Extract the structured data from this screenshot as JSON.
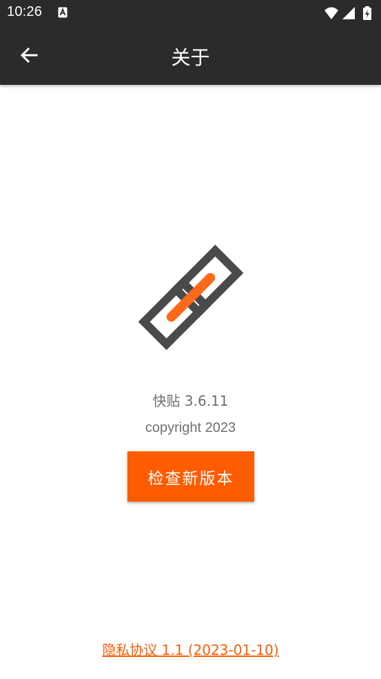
{
  "status_bar": {
    "time": "10:26",
    "icons": [
      "a-notification-icon",
      "wifi-icon",
      "cellular-signal-icon",
      "battery-charging-icon"
    ]
  },
  "app_bar": {
    "title": "关于",
    "back_icon": "arrow-left-icon"
  },
  "about": {
    "logo_icon": "chain-link-icon",
    "version": "快贴 3.6.11",
    "copyright": "copyright 2023",
    "check_update_label": "检查新版本",
    "privacy_link": "隐私协议 1.1 (2023-01-10)"
  },
  "colors": {
    "bar_background": "#2b2b2b",
    "accent": "#ff5c00",
    "text_muted": "#6f6f6f",
    "logo_dark": "#4a4a4a",
    "logo_orange": "#ff6a1a"
  }
}
